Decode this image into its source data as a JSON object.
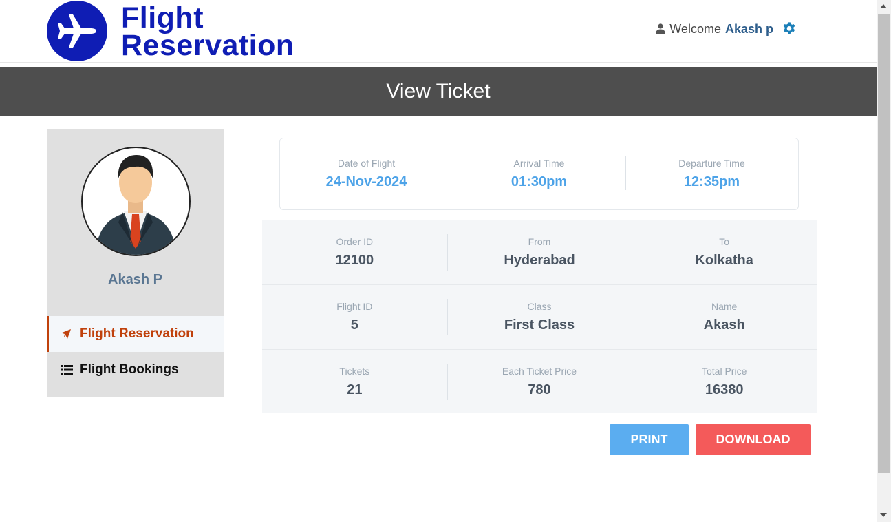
{
  "header": {
    "logo_line1": "Flight",
    "logo_line2": "Reservation",
    "welcome_text": "Welcome",
    "user_name": "Akash p",
    "user_icon": "user-icon",
    "settings_icon": "gear-icon"
  },
  "page_title": "View Ticket",
  "sidebar": {
    "profile_name": "Akash P",
    "items": [
      {
        "label": "Flight Reservation",
        "icon": "plane-icon",
        "active": true
      },
      {
        "label": "Flight Bookings",
        "icon": "list-icon",
        "active": false
      }
    ]
  },
  "flight_summary": {
    "date_label": "Date of Flight",
    "date_value": "24-Nov-2024",
    "arrival_label": "Arrival Time",
    "arrival_value": "01:30pm",
    "departure_label": "Departure Time",
    "departure_value": "12:35pm"
  },
  "details": {
    "order_id_label": "Order ID",
    "order_id_value": "12100",
    "from_label": "From",
    "from_value": "Hyderabad",
    "to_label": "To",
    "to_value": "Kolkatha",
    "flight_id_label": "Flight ID",
    "flight_id_value": "5",
    "class_label": "Class",
    "class_value": "First Class",
    "name_label": "Name",
    "name_value": "Akash",
    "tickets_label": "Tickets",
    "tickets_value": "21",
    "each_price_label": "Each Ticket Price",
    "each_price_value": "780",
    "total_price_label": "Total Price",
    "total_price_value": "16380"
  },
  "actions": {
    "print_label": "PRINT",
    "download_label": "DOWNLOAD"
  },
  "colors": {
    "brand": "#0f1db4",
    "accent_blue": "#4da3e8",
    "active_menu": "#c0410c",
    "download": "#f45a5a",
    "print": "#5badf0"
  }
}
